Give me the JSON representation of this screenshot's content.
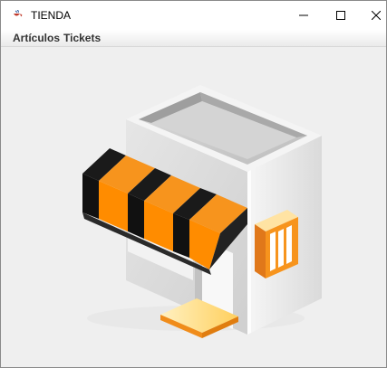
{
  "window": {
    "title": "TIENDA",
    "icon": "java-cup-icon",
    "controls": [
      "minimize-icon",
      "maximize-icon",
      "close-icon"
    ]
  },
  "menubar": {
    "items": [
      {
        "label": "Artículos"
      },
      {
        "label": "Tickets"
      }
    ]
  },
  "content": {
    "image": "store-illustration",
    "colors": {
      "awning_orange": "#f7941d",
      "awning_black": "#1a1a1a",
      "building_gray": "#d9d9d9",
      "window_orange": "#f7941d",
      "step_yellow": "#ffc94d"
    }
  }
}
